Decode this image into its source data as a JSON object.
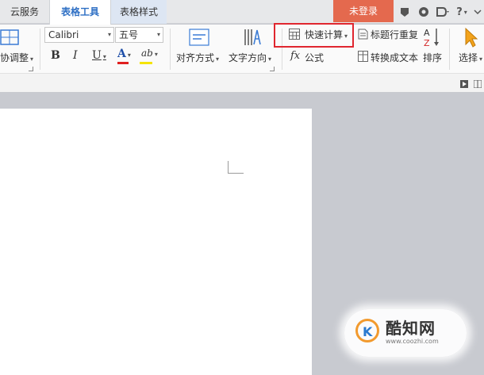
{
  "tabs": [
    {
      "label": "云服务"
    },
    {
      "label": "表格工具"
    },
    {
      "label": "表格样式"
    }
  ],
  "header": {
    "login_label": "未登录",
    "help_label": "?"
  },
  "ribbon": {
    "adjust_label": "协调整",
    "font_name": "Calibri",
    "font_size": "五号",
    "bold": "B",
    "italic": "I",
    "underline": "U",
    "font_color": "A",
    "highlight": "ab",
    "align_label": "对齐方式",
    "text_direction_label": "文字方向",
    "quick_calc_label": "快速计算",
    "formula_label": "公式",
    "formula_icon": "fx",
    "repeat_header_label": "标题行重复",
    "convert_text_label": "转换成文本",
    "sort_label": "排序",
    "select_label": "选择"
  },
  "colors": {
    "accent": "#2e6fc4",
    "login_bg": "#e4694e",
    "highlight_border": "#e0262f",
    "font_color_bar": "#e02020",
    "highlight_bar": "#f5e400"
  },
  "watermark": {
    "title": "酷知网",
    "url": "www.coozhi.com",
    "logo_text": "K"
  }
}
